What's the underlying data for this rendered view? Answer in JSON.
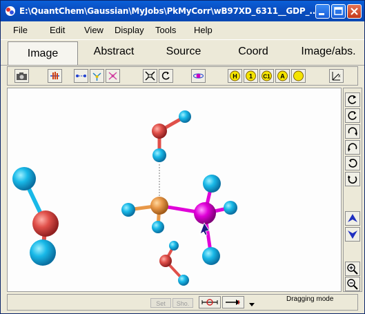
{
  "window": {
    "title": "E:\\QuantChem\\Gaussian\\MyJobs\\PkMyCorr\\wB97XD_6311__GDP_...",
    "controls": [
      "minimize-icon",
      "maximize-icon",
      "close-icon"
    ]
  },
  "menu": {
    "items": [
      "File",
      "Edit",
      "View",
      "Display",
      "Tools",
      "Help"
    ]
  },
  "tabs": {
    "items": [
      "Image",
      "Abstract",
      "Source",
      "Coord",
      "Image/abs."
    ],
    "active": "Image"
  },
  "toolbar": {
    "tools": [
      "camera-icon",
      "rotate-hand-icon",
      "bond-length-icon",
      "bond-angle-icon",
      "dihedral-icon",
      "fit-window-icon",
      "reset-view-icon",
      "orbit-icon",
      "show-h-icon",
      "atom-number-icon",
      "c1-label-icon",
      "atom-label-icon",
      "ball-icon",
      "axes-icon"
    ],
    "label_h": "H",
    "label_one": "1",
    "label_c1": "C1",
    "label_a": "A",
    "label_axes": "x"
  },
  "sidebar": {
    "tools": [
      "rotate-x-cw-icon",
      "rotate-x-ccw-icon",
      "rotate-y-cw-icon",
      "rotate-y-ccw-icon",
      "rotate-z-cw-icon",
      "rotate-z-ccw-icon",
      "move-up-icon",
      "move-down-icon",
      "zoom-in-icon",
      "zoom-out-icon"
    ]
  },
  "status": {
    "set_label": "Set",
    "show_label": "Sho.",
    "mode": "Dragging mode"
  },
  "colors": {
    "titlebar": "#0b4fc2",
    "hydrogen": "#19b9e8",
    "oxygen": "#e0504a",
    "phosphorus": "#e89848",
    "selected_atom": "#e000d8",
    "background": "#ece9d8"
  }
}
